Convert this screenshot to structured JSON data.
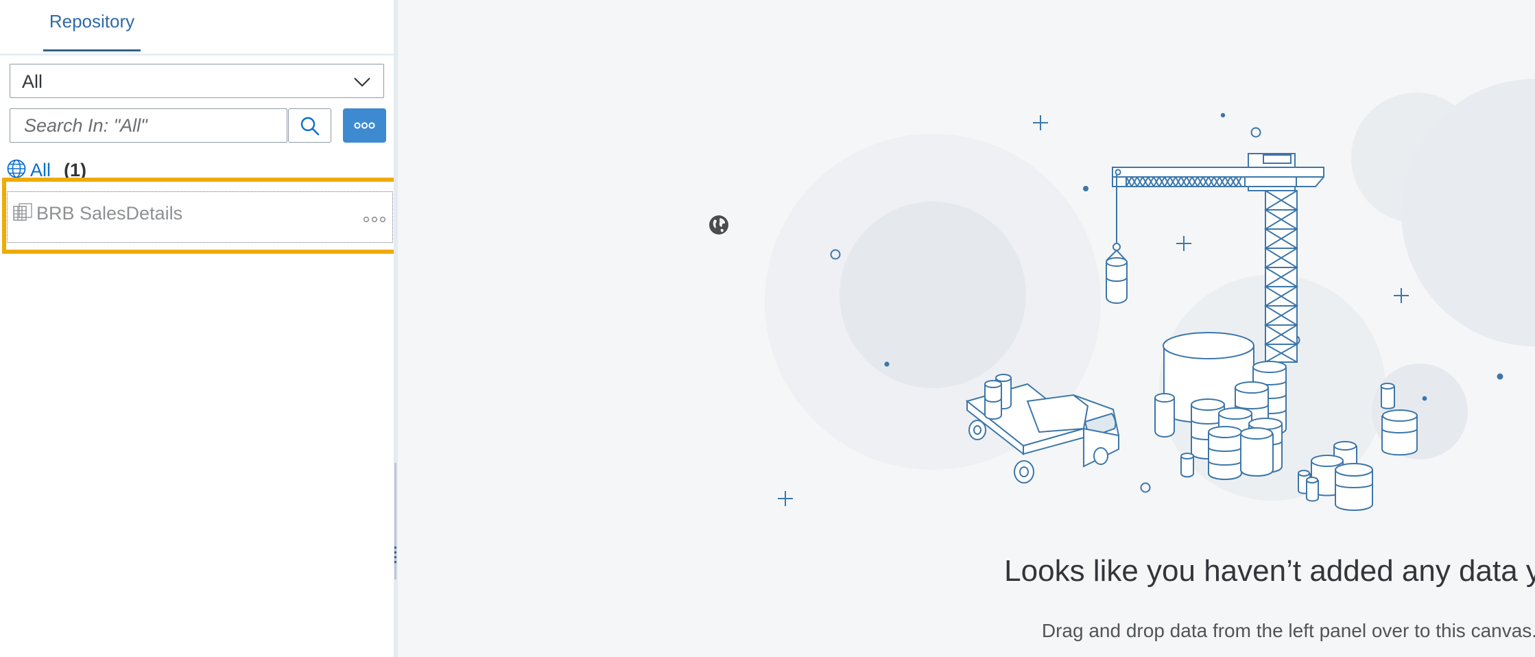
{
  "tabs": {
    "repository": "Repository"
  },
  "filter": {
    "selected": "All"
  },
  "search": {
    "placeholder": "Search In: \"All\""
  },
  "tree": {
    "root_label": "All",
    "root_count": "(1)",
    "items": [
      {
        "label": "BRB SalesDetails"
      }
    ]
  },
  "more_dots": "∘∘∘",
  "canvas": {
    "empty_title": "Looks like you haven’t added any data yet.",
    "empty_subtitle": "Drag and drop data from the left panel over to this canvas."
  },
  "colors": {
    "accent": "#0a6ed1",
    "more_button": "#3d8ad1",
    "highlight": "#f0ab00",
    "illustration_line": "#3c76aa"
  },
  "icons": [
    "chevron-down-icon",
    "search-icon",
    "more-icon",
    "globe-icon",
    "table-icon",
    "world-icon"
  ]
}
